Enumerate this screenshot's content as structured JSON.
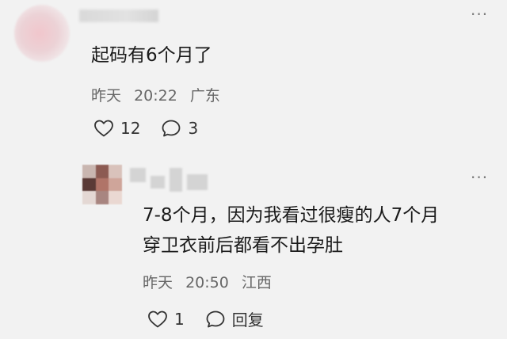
{
  "comments": [
    {
      "text": "起码有6个月了",
      "date": "昨天",
      "time": "20:22",
      "location": "广东",
      "like_count": "12",
      "reply_count": "3"
    }
  ],
  "reply": {
    "lines": [
      "7-8个月，因为我看过很瘦的人7个月",
      "穿卫衣前后都看不出孕肚"
    ],
    "date": "昨天",
    "time": "20:50",
    "location": "江西",
    "like_count": "1",
    "reply_label": "回复"
  },
  "icons": {
    "more": "more-icon",
    "like": "heart-icon",
    "comment": "comment-icon"
  },
  "colors": {
    "background": "#f2f2f2",
    "text": "#1a1a1a",
    "meta": "#666666",
    "icon": "#333333"
  }
}
